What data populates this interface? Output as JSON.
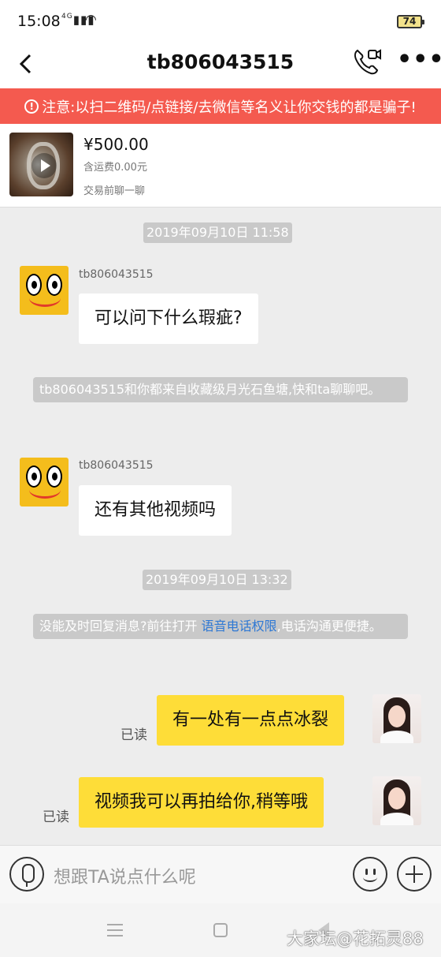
{
  "status_bar": {
    "time": "15:08",
    "signal": "4G",
    "battery": "74"
  },
  "header": {
    "title": "tb806043515"
  },
  "warning": {
    "text": "注意:以扫二维码/点链接/去微信等名义让你交钱的都是骗子!"
  },
  "product": {
    "price": "¥500.00",
    "shipping": "含运费0.00元",
    "note": "交易前聊一聊"
  },
  "chat": {
    "timestamps": [
      "2019年09月10日 11:58",
      "2019年09月10日 13:32"
    ],
    "messages": [
      {
        "sender": "tb806043515",
        "text": "可以问下什么瑕疵?"
      },
      {
        "sender": "tb806043515",
        "text": "还有其他视频吗"
      },
      {
        "text": "有一处有一点点冰裂",
        "status": "已读"
      },
      {
        "text": "视频我可以再拍给你,稍等哦",
        "status": "已读"
      }
    ],
    "system": [
      {
        "text": "tb806043515和你都来自收藏级月光石鱼塘,快和ta聊聊吧。"
      },
      {
        "prefix": "没能及时回复消息?前往打开 ",
        "link": "语音电话权限",
        "suffix": ",电话沟通更便捷。"
      }
    ]
  },
  "input": {
    "placeholder": "想跟TA说点什么呢"
  },
  "watermark": "大家坛@花拓灵88"
}
